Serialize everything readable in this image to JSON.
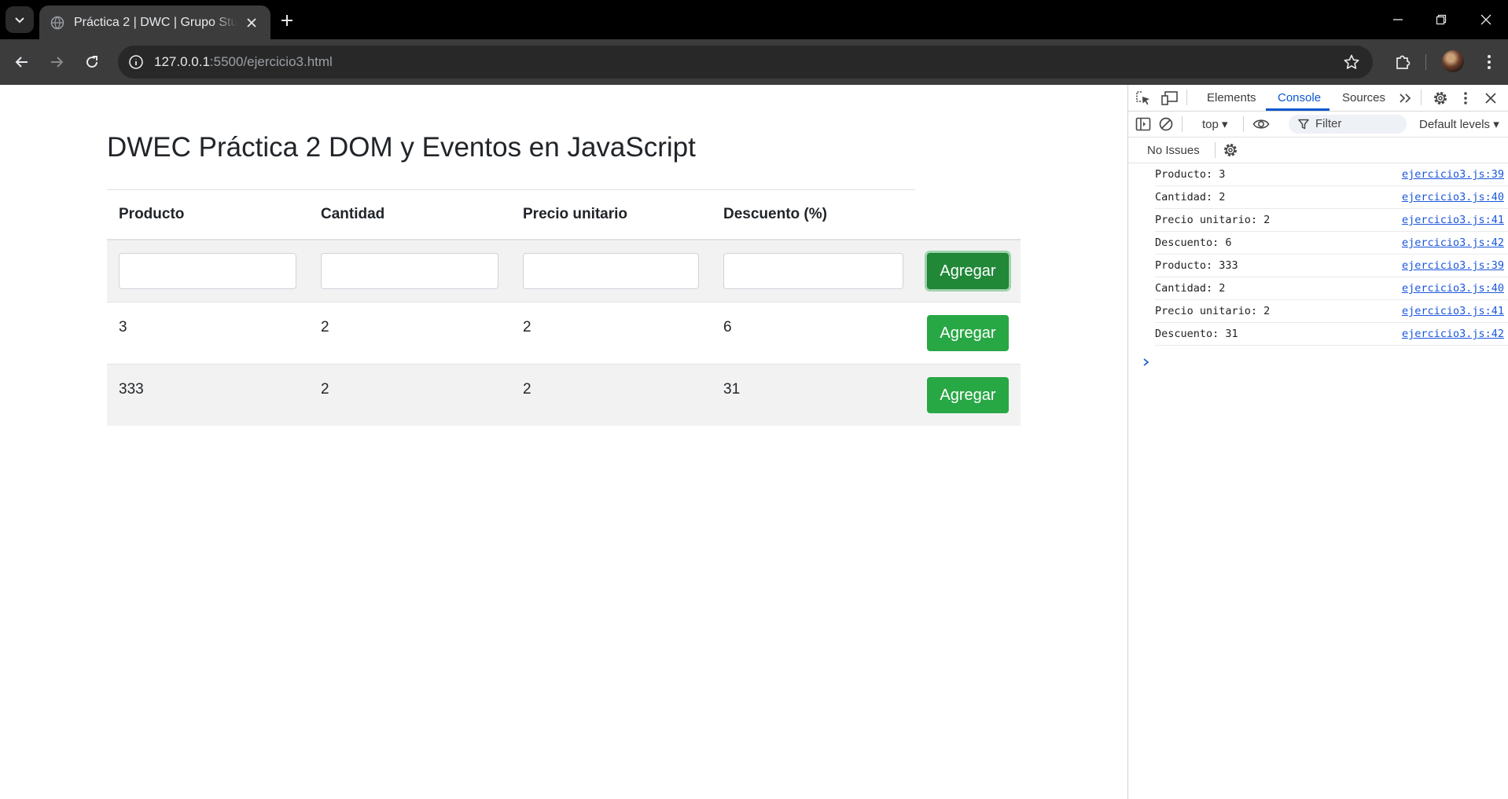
{
  "browser": {
    "tab_title": "Práctica 2 | DWC | Grupo Studium",
    "url_host": "127.0.0.1",
    "url_rest": ":5500/ejercicio3.html"
  },
  "page": {
    "heading": "DWEC Práctica 2 DOM y Eventos en JavaScript",
    "table": {
      "headers": [
        "Producto",
        "Cantidad",
        "Precio unitario",
        "Descuento (%)"
      ],
      "button_label": "Agregar",
      "rows": [
        [
          "3",
          "2",
          "2",
          "6"
        ],
        [
          "333",
          "2",
          "2",
          "31"
        ]
      ]
    }
  },
  "devtools": {
    "tabs": [
      "Elements",
      "Console",
      "Sources"
    ],
    "active_tab": "Console",
    "context": "top",
    "filter_placeholder": "Filter",
    "levels": "Default levels",
    "issues": "No Issues",
    "logs": [
      {
        "msg": "Producto: 3",
        "src": "ejercicio3.js:39"
      },
      {
        "msg": "Cantidad: 2",
        "src": "ejercicio3.js:40"
      },
      {
        "msg": "Precio unitario: 2",
        "src": "ejercicio3.js:41"
      },
      {
        "msg": "Descuento: 6",
        "src": "ejercicio3.js:42"
      },
      {
        "msg": "Producto: 333",
        "src": "ejercicio3.js:39"
      },
      {
        "msg": "Cantidad: 2",
        "src": "ejercicio3.js:40"
      },
      {
        "msg": "Precio unitario: 2",
        "src": "ejercicio3.js:41"
      },
      {
        "msg": "Descuento: 31",
        "src": "ejercicio3.js:42"
      }
    ]
  },
  "colors": {
    "button_green": "#28a745",
    "devtools_accent": "#0b57d0"
  }
}
